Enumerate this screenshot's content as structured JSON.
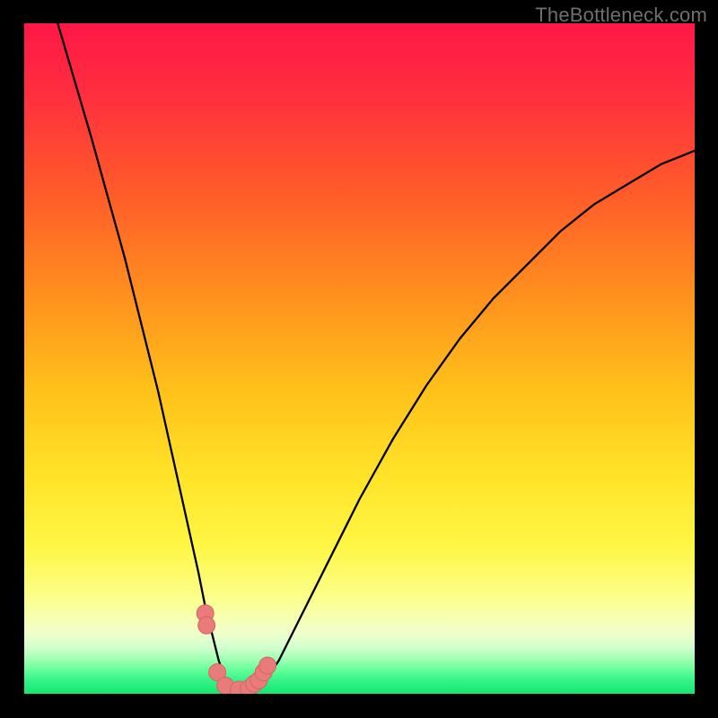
{
  "watermark": "TheBottleneck.com",
  "colors": {
    "black": "#000000",
    "curve": "#000000",
    "marker_fill": "#e97b7b",
    "marker_stroke": "#d46565",
    "gradient_stops": [
      {
        "offset": 0.0,
        "color": "#ff1747"
      },
      {
        "offset": 0.1,
        "color": "#ff2d3f"
      },
      {
        "offset": 0.25,
        "color": "#ff5a2a"
      },
      {
        "offset": 0.4,
        "color": "#ff8e1e"
      },
      {
        "offset": 0.55,
        "color": "#ffc21a"
      },
      {
        "offset": 0.68,
        "color": "#ffe429"
      },
      {
        "offset": 0.78,
        "color": "#fff645"
      },
      {
        "offset": 0.86,
        "color": "#fbff8e"
      },
      {
        "offset": 0.905,
        "color": "#f2ffc7"
      },
      {
        "offset": 0.928,
        "color": "#d7ffd0"
      },
      {
        "offset": 0.946,
        "color": "#a8ffb7"
      },
      {
        "offset": 0.962,
        "color": "#6fff9e"
      },
      {
        "offset": 0.978,
        "color": "#39f58a"
      },
      {
        "offset": 1.0,
        "color": "#14e66f"
      }
    ]
  },
  "chart_data": {
    "type": "line",
    "title": "",
    "xlabel": "",
    "ylabel": "",
    "xlim": [
      0,
      100
    ],
    "ylim": [
      0,
      100
    ],
    "x": [
      5,
      10,
      15,
      20,
      22,
      24,
      26,
      27,
      28,
      29,
      30,
      31,
      32,
      33,
      34,
      36,
      38,
      40,
      45,
      50,
      55,
      60,
      65,
      70,
      75,
      80,
      85,
      90,
      95,
      100
    ],
    "values": [
      100,
      83,
      65,
      45,
      36,
      27,
      18,
      13,
      9,
      5,
      2,
      0.5,
      0,
      0,
      0.5,
      2,
      5,
      9,
      19,
      29,
      38,
      46,
      53,
      59,
      64,
      69,
      73,
      76,
      79,
      81
    ],
    "markers": {
      "x": [
        27.0,
        27.2,
        28.8,
        30.0,
        32.0,
        33.5,
        34.3,
        35.0,
        35.7,
        36.3
      ],
      "y": [
        12.0,
        10.2,
        3.2,
        1.2,
        0.6,
        0.8,
        1.5,
        2.0,
        3.2,
        4.2
      ]
    }
  }
}
